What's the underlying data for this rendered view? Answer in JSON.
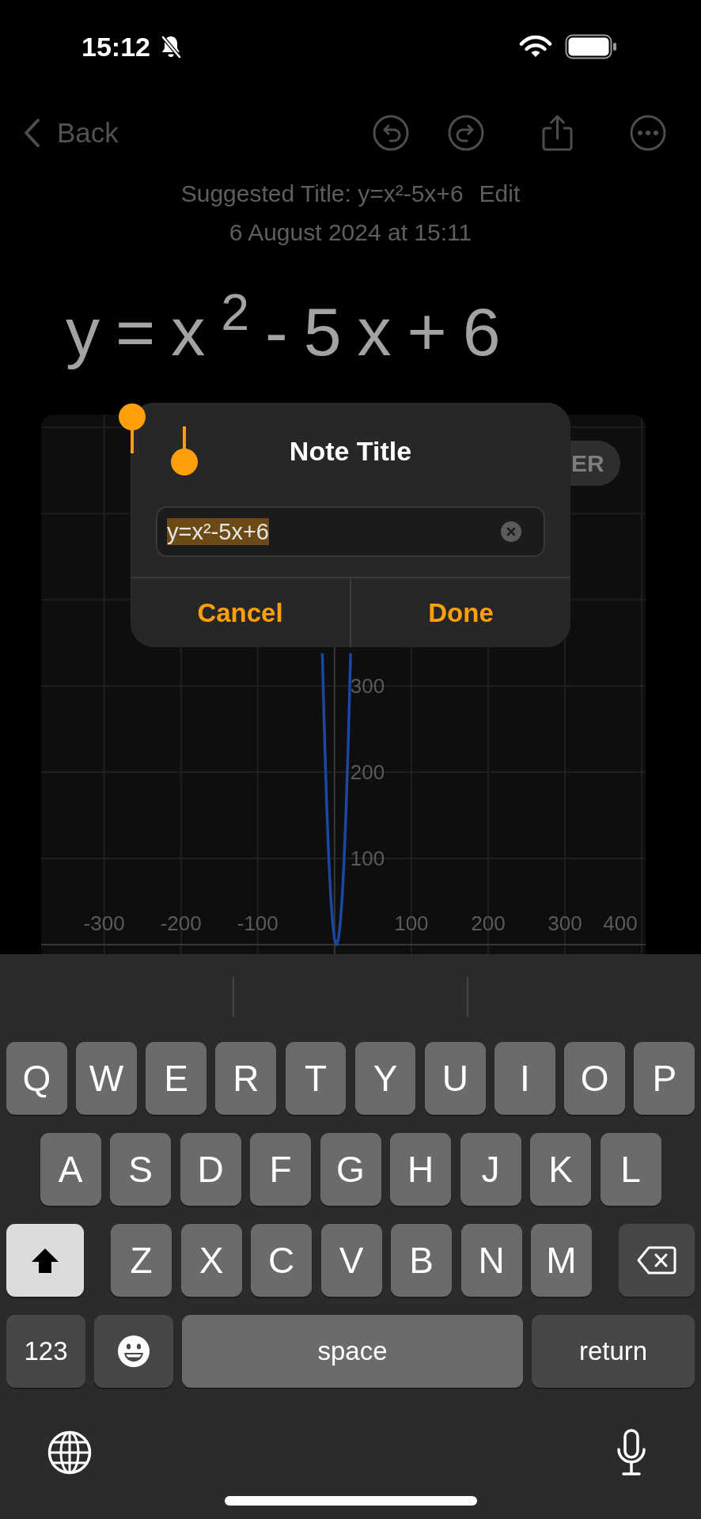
{
  "status_bar": {
    "time": "15:12"
  },
  "nav_bar": {
    "back_label": "Back"
  },
  "note": {
    "suggested_title": "Suggested Title: y=x²-5x+6",
    "edit_link": "Edit",
    "date": "6 August 2024 at 15:11",
    "handwriting": "y=x$^{2}$-5x+6"
  },
  "graph": {
    "mode_button": "ER",
    "chart_data": {
      "type": "line",
      "x": [
        -15.9,
        -15,
        -12.5,
        -10,
        -7.5,
        -5,
        -2.5,
        0,
        2.5,
        5,
        7.5,
        10,
        12.5,
        15,
        17.5,
        20,
        20.9
      ],
      "series": [
        {
          "color": "#1b47a3",
          "values": [
            338,
            306,
            225,
            156,
            100,
            56,
            25,
            6,
            0,
            6,
            25,
            56,
            100,
            156,
            225,
            306,
            338
          ]
        }
      ],
      "xlim": [
        -382,
        405
      ],
      "ylim": [
        -11,
        615
      ],
      "xticks": [
        -300,
        -200,
        -100,
        100,
        200,
        300,
        400
      ],
      "yticks": [
        100,
        200,
        300
      ],
      "grid": true
    }
  },
  "dialog": {
    "title": "Note Title",
    "field": {
      "value": "y=x²-5x+6",
      "selected": true
    },
    "buttons": [
      "Cancel",
      "Done"
    ]
  },
  "keyboard": {
    "letter_rows": [
      [
        "Q",
        "W",
        "E",
        "R",
        "T",
        "Y",
        "U",
        "I",
        "O",
        "P"
      ],
      [
        "A",
        "S",
        "D",
        "F",
        "G",
        "H",
        "J",
        "K",
        "L"
      ],
      [
        "Z",
        "X",
        "C",
        "V",
        "B",
        "N",
        "M"
      ]
    ],
    "shift_on": true,
    "numbers_key": "123",
    "space_key": "space",
    "return_key": "return"
  }
}
